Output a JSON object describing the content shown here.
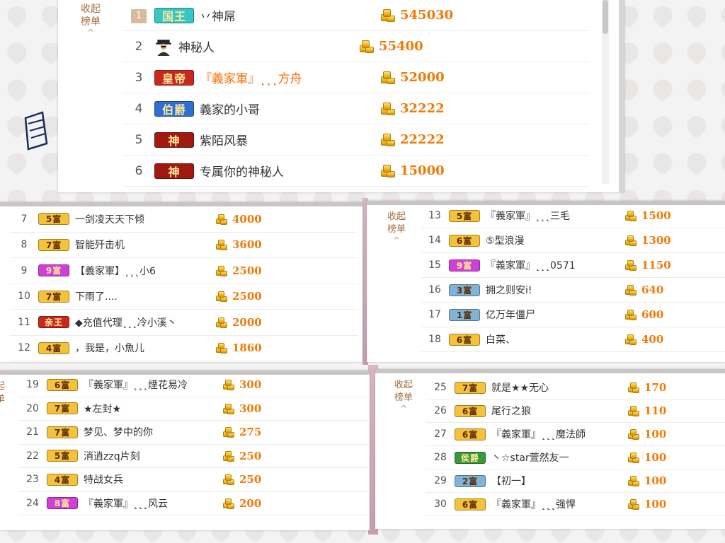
{
  "ui": {
    "collapse_label_line1": "收起",
    "collapse_label_line2": "榜单",
    "collapse_chevron": "^",
    "colors": {
      "amount": "#f07a06",
      "accent": "#a36e3d"
    }
  },
  "leaderboard": [
    {
      "rank": "1",
      "badge": "国王",
      "badge_color": "#38c7c7",
      "name": "丷神屌",
      "amount": "545030"
    },
    {
      "rank": "2",
      "badge": "",
      "badge_icon": "mystery-person-icon",
      "name": "神秘人",
      "amount": "55400"
    },
    {
      "rank": "3",
      "badge": "皇帝",
      "badge_color": "#c8281e",
      "name": "『義家軍』˛˛˛方舟",
      "amount": "52000",
      "highlight": true
    },
    {
      "rank": "4",
      "badge": "伯爵",
      "badge_color": "#2e6fd1",
      "name": "義家的小哥",
      "amount": "32222"
    },
    {
      "rank": "5",
      "badge": "神",
      "badge_color": "#a01a12",
      "name": "紫陌风暴",
      "amount": "22222"
    },
    {
      "rank": "6",
      "badge": "神",
      "badge_color": "#a01a12",
      "name": "专属你的神秘人",
      "amount": "15000"
    },
    {
      "rank": "7",
      "badge": "5富",
      "badge_color": "#f5c23a",
      "name": "一剑凌天天下倾",
      "amount": "4000"
    },
    {
      "rank": "8",
      "badge": "7富",
      "badge_color": "#f5c23a",
      "name": "智能歼击机",
      "amount": "3600"
    },
    {
      "rank": "9",
      "badge": "9富",
      "badge_color": "#d23fd6",
      "name": "【義家軍】˛˛˛小6",
      "amount": "2500"
    },
    {
      "rank": "10",
      "badge": "7富",
      "badge_color": "#f5c23a",
      "name": "下雨了....",
      "amount": "2500"
    },
    {
      "rank": "11",
      "badge": "亲王",
      "badge_color": "#c8281e",
      "name": "◆充值代理˛˛˛冷小溪丶",
      "amount": "2000"
    },
    {
      "rank": "12",
      "badge": "4富",
      "badge_color": "#f5c23a",
      "name": "，我是，小魚儿",
      "amount": "1860"
    },
    {
      "rank": "13",
      "badge": "5富",
      "badge_color": "#f5c23a",
      "name": "『義家軍』˛˛˛三毛",
      "amount": "1500"
    },
    {
      "rank": "14",
      "badge": "6富",
      "badge_color": "#f5c23a",
      "name": "⑤型浪漫",
      "amount": "1300"
    },
    {
      "rank": "15",
      "badge": "9富",
      "badge_color": "#d23fd6",
      "name": "『義家軍』˛˛˛0571",
      "amount": "1150"
    },
    {
      "rank": "16",
      "badge": "3富",
      "badge_color": "#7fb3d8",
      "name": "拥之则安i!",
      "amount": "640"
    },
    {
      "rank": "17",
      "badge": "1富",
      "badge_color": "#7fb3d8",
      "name": "亿万年僵尸",
      "amount": "600"
    },
    {
      "rank": "18",
      "badge": "6富",
      "badge_color": "#f5c23a",
      "name": "白菜、",
      "amount": "400"
    },
    {
      "rank": "19",
      "badge": "6富",
      "badge_color": "#f5c23a",
      "name": "『義家軍』˛˛˛煙花易冷",
      "amount": "300"
    },
    {
      "rank": "20",
      "badge": "7富",
      "badge_color": "#f5c23a",
      "name": "★左封★",
      "amount": "300"
    },
    {
      "rank": "21",
      "badge": "7富",
      "badge_color": "#f5c23a",
      "name": "梦见、梦中的你",
      "amount": "275"
    },
    {
      "rank": "22",
      "badge": "5富",
      "badge_color": "#f5c23a",
      "name": "消逍zzq片刻",
      "amount": "250"
    },
    {
      "rank": "23",
      "badge": "4富",
      "badge_color": "#f5c23a",
      "name": "特战女兵",
      "amount": "250"
    },
    {
      "rank": "24",
      "badge": "8富",
      "badge_color": "#d23fd6",
      "name": "『義家軍』˛˛˛风云",
      "amount": "200"
    },
    {
      "rank": "25",
      "badge": "7富",
      "badge_color": "#f5c23a",
      "name": "就是★★无心",
      "amount": "170"
    },
    {
      "rank": "26",
      "badge": "6富",
      "badge_color": "#f5c23a",
      "name": "尾行之狼",
      "amount": "110"
    },
    {
      "rank": "27",
      "badge": "6富",
      "badge_color": "#f5c23a",
      "name": "『義家軍』˛˛˛魔法師",
      "amount": "100"
    },
    {
      "rank": "28",
      "badge": "侯爵",
      "badge_color": "#3a9a3a",
      "name": "丶☆star萱然友一",
      "amount": "100"
    },
    {
      "rank": "29",
      "badge": "2富",
      "badge_color": "#7fb3d8",
      "name": "【初一】",
      "amount": "100"
    },
    {
      "rank": "30",
      "badge": "6富",
      "badge_color": "#f5c23a",
      "name": "『義家軍』˛˛˛强悍",
      "amount": "100"
    }
  ]
}
